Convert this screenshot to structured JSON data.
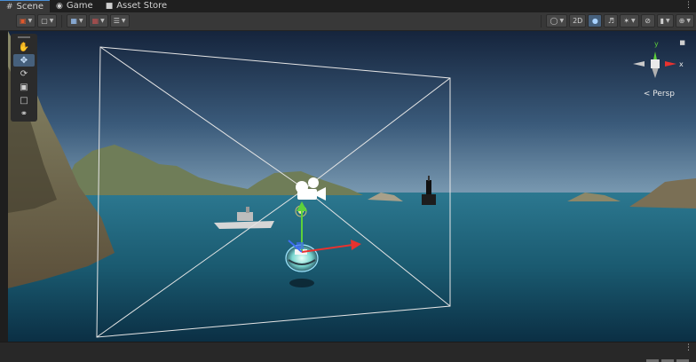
{
  "tabs": [
    {
      "label": "Scene",
      "icon": "grid-icon",
      "active": true
    },
    {
      "label": "Game",
      "icon": "gamepad-icon",
      "active": false
    },
    {
      "label": "Asset Store",
      "icon": "bag-icon",
      "active": false
    }
  ],
  "toolbar": {
    "mode_2d_label": "2D",
    "left_tools": [
      "draw-mode-icon",
      "render-mode-icon",
      "grid-snap-icon",
      "increment-snap-icon",
      "align-icon"
    ],
    "right_tools": [
      "shading-mode-icon",
      "lighting-icon",
      "audio-icon",
      "effects-icon",
      "visibility-icon",
      "camera-icon",
      "gizmos-icon"
    ]
  },
  "tool_palette": [
    "hand-tool",
    "move-tool",
    "rotate-tool",
    "scale-tool",
    "rect-tool",
    "transform-tool"
  ],
  "tool_palette_selected": "move-tool",
  "gizmo": {
    "x_label": "x",
    "y_label": "y",
    "projection_label": "Persp"
  },
  "colors": {
    "x_axis": "#e8322f",
    "y_axis": "#5dd13a",
    "z_axis": "#3f6cf5",
    "sky_top": "#1b2c48",
    "sea": "#1d5e74",
    "selection_blue": "#46607c"
  }
}
